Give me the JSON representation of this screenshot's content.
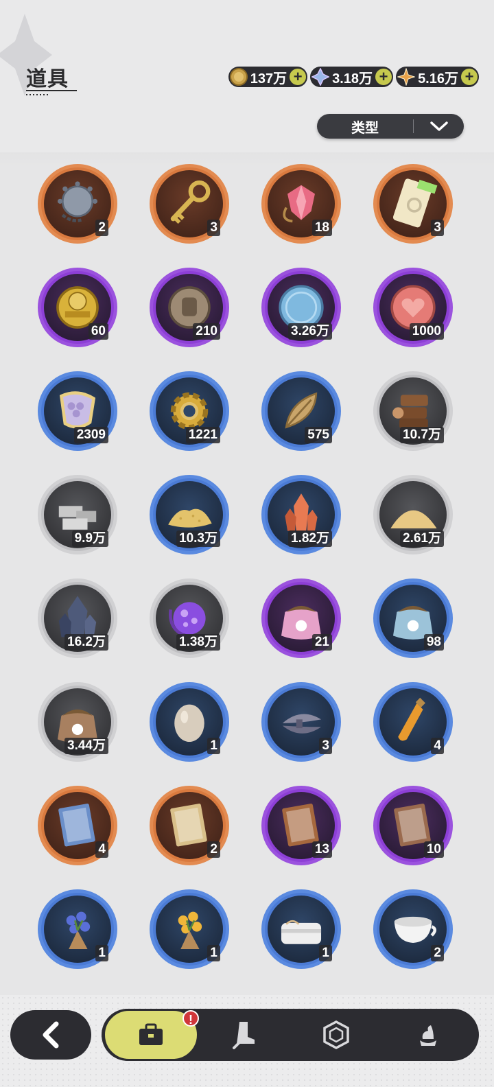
{
  "header": {
    "title": "道具"
  },
  "currencies": [
    {
      "name": "coin",
      "value": "137万",
      "icon": "gold-coin-icon",
      "color": "#c9a24a"
    },
    {
      "name": "crystal",
      "value": "3.18万",
      "icon": "crystal-icon",
      "color": "#9ab7e8"
    },
    {
      "name": "star-gem",
      "value": "5.16万",
      "icon": "star-gem-icon",
      "color": "#e8a24a"
    }
  ],
  "filter": {
    "label": "类型"
  },
  "items": [
    {
      "name": "spiked-mine",
      "rarity": "orange",
      "count": "2",
      "icon": "mine-icon"
    },
    {
      "name": "golden-key",
      "rarity": "orange",
      "count": "3",
      "icon": "key-icon"
    },
    {
      "name": "red-gem",
      "rarity": "orange",
      "count": "18",
      "icon": "gem-icon"
    },
    {
      "name": "rainbow-ticket",
      "rarity": "orange",
      "count": "3",
      "icon": "ticket-icon"
    },
    {
      "name": "football-coin",
      "rarity": "purple",
      "count": "60",
      "icon": "football-coin-icon"
    },
    {
      "name": "fist-coin",
      "rarity": "purple",
      "count": "210",
      "icon": "fist-coin-icon"
    },
    {
      "name": "blue-coin",
      "rarity": "purple",
      "count": "3.26万",
      "icon": "blue-coin-icon"
    },
    {
      "name": "heart-coin",
      "rarity": "purple",
      "count": "1000",
      "icon": "heart-coin-icon"
    },
    {
      "name": "scale-badge",
      "rarity": "blue",
      "count": "2309",
      "icon": "scale-icon"
    },
    {
      "name": "gear",
      "rarity": "blue",
      "count": "1221",
      "icon": "gear-icon"
    },
    {
      "name": "leaf",
      "rarity": "blue",
      "count": "575",
      "icon": "leaf-icon"
    },
    {
      "name": "logs",
      "rarity": "gray",
      "count": "10.7万",
      "icon": "logs-icon"
    },
    {
      "name": "stone-bricks",
      "rarity": "gray",
      "count": "9.9万",
      "icon": "bricks-icon"
    },
    {
      "name": "gold-sand",
      "rarity": "blue",
      "count": "10.3万",
      "icon": "sand-icon"
    },
    {
      "name": "orange-crystal",
      "rarity": "blue",
      "count": "1.82万",
      "icon": "crystal-cluster-icon"
    },
    {
      "name": "sand-pile",
      "rarity": "gray",
      "count": "2.61万",
      "icon": "sand-pile-icon"
    },
    {
      "name": "dark-crystal",
      "rarity": "gray",
      "count": "16.2万",
      "icon": "dark-crystal-icon"
    },
    {
      "name": "purple-orb",
      "rarity": "gray",
      "count": "1.38万",
      "icon": "orb-icon"
    },
    {
      "name": "pink-food-bag",
      "rarity": "purple",
      "count": "21",
      "icon": "food-bag-icon"
    },
    {
      "name": "blue-food-bag",
      "rarity": "blue",
      "count": "98",
      "icon": "food-bag-icon"
    },
    {
      "name": "brown-food-bag",
      "rarity": "gray",
      "count": "3.44万",
      "icon": "food-bag-icon"
    },
    {
      "name": "egg",
      "rarity": "blue",
      "count": "1",
      "icon": "egg-icon"
    },
    {
      "name": "feather-bundle",
      "rarity": "blue",
      "count": "3",
      "icon": "feathers-icon"
    },
    {
      "name": "potion",
      "rarity": "blue",
      "count": "4",
      "icon": "potion-icon"
    },
    {
      "name": "blue-book",
      "rarity": "orange",
      "count": "4",
      "icon": "book-icon"
    },
    {
      "name": "golden-book",
      "rarity": "orange",
      "count": "2",
      "icon": "book-icon"
    },
    {
      "name": "brown-book",
      "rarity": "purple",
      "count": "13",
      "icon": "book-icon"
    },
    {
      "name": "sword-book",
      "rarity": "purple",
      "count": "10",
      "icon": "book-icon"
    },
    {
      "name": "blue-bouquet",
      "rarity": "blue",
      "count": "1",
      "icon": "bouquet-icon"
    },
    {
      "name": "yellow-bouquet",
      "rarity": "blue",
      "count": "1",
      "icon": "bouquet-icon"
    },
    {
      "name": "towel",
      "rarity": "blue",
      "count": "1",
      "icon": "towel-icon"
    },
    {
      "name": "teacup",
      "rarity": "blue",
      "count": "2",
      "icon": "teacup-icon"
    }
  ],
  "nav": {
    "badge": "!",
    "tabs": [
      {
        "name": "bag",
        "icon": "bag-icon",
        "active": true
      },
      {
        "name": "equipment",
        "icon": "boot-sword-icon",
        "active": false
      },
      {
        "name": "gem",
        "icon": "hexagon-gem-icon",
        "active": false
      },
      {
        "name": "food",
        "icon": "dessert-icon",
        "active": false
      }
    ]
  }
}
